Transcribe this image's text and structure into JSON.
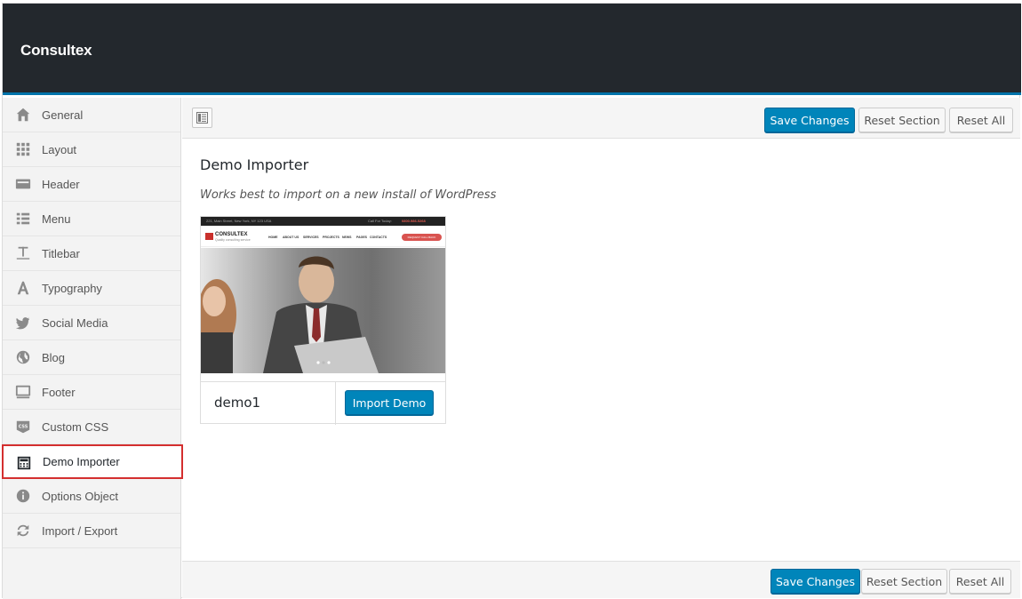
{
  "app": {
    "title": "Consultex"
  },
  "sidebar": {
    "items": [
      {
        "label": "General",
        "icon": "home-icon"
      },
      {
        "label": "Layout",
        "icon": "grid-icon"
      },
      {
        "label": "Header",
        "icon": "header-icon"
      },
      {
        "label": "Menu",
        "icon": "menu-list-icon"
      },
      {
        "label": "Titlebar",
        "icon": "text-cursor-icon"
      },
      {
        "label": "Typography",
        "icon": "font-icon"
      },
      {
        "label": "Social Media",
        "icon": "twitter-icon"
      },
      {
        "label": "Blog",
        "icon": "globe-icon"
      },
      {
        "label": "Footer",
        "icon": "monitor-icon"
      },
      {
        "label": "Custom CSS",
        "icon": "css-icon"
      },
      {
        "label": "Demo Importer",
        "icon": "importer-icon",
        "active": true
      },
      {
        "label": "Options Object",
        "icon": "info-icon"
      },
      {
        "label": "Import / Export",
        "icon": "refresh-icon"
      }
    ]
  },
  "toolbar": {
    "save_label": "Save Changes",
    "reset_section_label": "Reset Section",
    "reset_all_label": "Reset All"
  },
  "section": {
    "title": "Demo Importer",
    "description": "Works best to import on a new install of WordPress"
  },
  "demos": [
    {
      "name": "demo1",
      "import_label": "Import Demo",
      "preview": {
        "brand": "CONSULTEX",
        "tagline": "Quality consulting service",
        "address": "221, Main Street, New York, NY 123 USA",
        "phone_label": "Call For Today:",
        "phone": "0800.986.5268",
        "menu": [
          "HOME",
          "ABOUT US",
          "SERVICES",
          "PROJECTS",
          "NEWS",
          "PAGES",
          "CONTACTS"
        ],
        "cta": "REQUEST CALL BACK"
      }
    }
  ],
  "colors": {
    "topbar": "#23282d",
    "accent": "#0073aa",
    "primary_button": "#0085ba",
    "active_outline": "#d42f2f"
  }
}
